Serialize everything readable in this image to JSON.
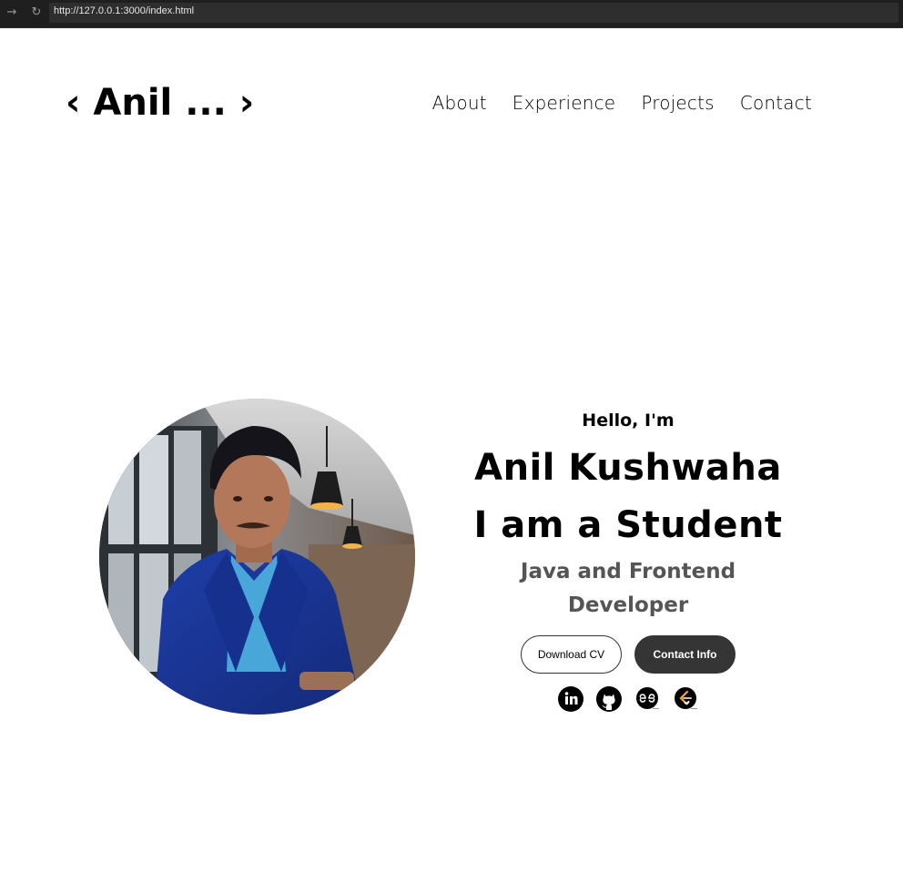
{
  "browser": {
    "url": "http://127.0.0.1:3000/index.html",
    "forward_icon": "arrow-right-icon",
    "reload_icon": "reload-icon"
  },
  "header": {
    "logo": "‹ Anil ... ›",
    "nav": [
      {
        "label": "About"
      },
      {
        "label": "Experience"
      },
      {
        "label": "Projects"
      },
      {
        "label": "Contact"
      }
    ]
  },
  "hero": {
    "greeting": "Hello, I'm",
    "name": "Anil Kushwaha",
    "role": "I am a Student",
    "subtitle": "Java and Frontend Developer",
    "buttons": {
      "download_cv": "Download CV",
      "contact_info": "Contact Info"
    },
    "social_icons": [
      "linkedin-icon",
      "github-icon",
      "geeksforgeeks-icon",
      "leetcode-icon"
    ],
    "profile_image": "profile-photo"
  },
  "colors": {
    "text": "#000000",
    "subtitle": "#555555",
    "button_dark": "#353535",
    "browser_bar": "#1f1f1f"
  }
}
